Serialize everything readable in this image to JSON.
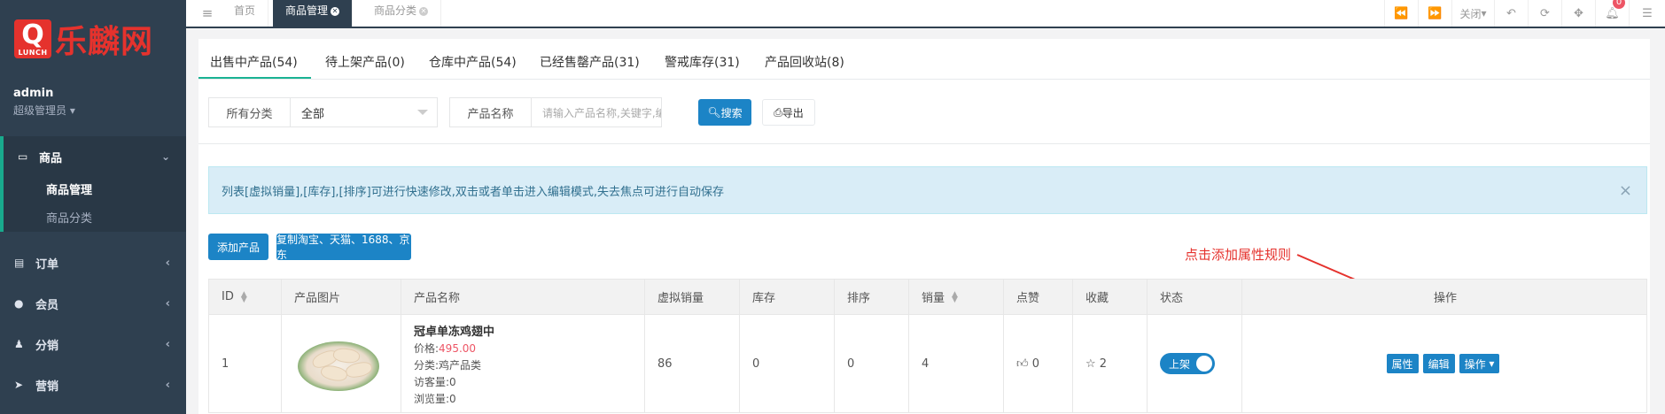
{
  "brand": {
    "logo_mark": "Q",
    "logo_sub": "LUNCH",
    "logo_text": "乐麟网"
  },
  "user": {
    "name": "admin",
    "role": "超级管理员"
  },
  "sidebar": {
    "goods": {
      "label": "商品",
      "items": [
        {
          "label": "商品管理"
        },
        {
          "label": "商品分类"
        }
      ]
    },
    "items": [
      {
        "label": "订单"
      },
      {
        "label": "会员"
      },
      {
        "label": "分销"
      },
      {
        "label": "营销"
      }
    ]
  },
  "page_tabs": [
    {
      "label": "首页"
    },
    {
      "label": "商品管理"
    },
    {
      "label": "商品分类"
    }
  ],
  "toolbar": {
    "close_label": "关闭",
    "notification_count": "0"
  },
  "content_tabs": [
    {
      "label": "出售中产品(54)"
    },
    {
      "label": "待上架产品(0)"
    },
    {
      "label": "仓库中产品(54)"
    },
    {
      "label": "已经售罄产品(31)"
    },
    {
      "label": "警戒库存(31)"
    },
    {
      "label": "产品回收站(8)"
    }
  ],
  "filters": {
    "category_label": "所有分类",
    "category_value": "全部",
    "name_label": "产品名称",
    "name_placeholder": "请输入产品名称,关键字,编号",
    "search_label": "搜索",
    "export_label": "导出"
  },
  "alert": {
    "text": "列表[虚拟销量],[库存],[排序]可进行快速修改,双击或者单击进入编辑模式,失去焦点可进行自动保存"
  },
  "actions": {
    "add_label": "添加产品",
    "copy_label": "复制淘宝、天猫、1688、京东"
  },
  "annotation": "点击添加属性规则",
  "table": {
    "headers": [
      "ID",
      "产品图片",
      "产品名称",
      "虚拟销量",
      "库存",
      "排序",
      "销量",
      "点赞",
      "收藏",
      "状态",
      "操作"
    ],
    "rows": [
      {
        "id": "1",
        "name": "冠卓单冻鸡翅中",
        "price_label": "价格:",
        "price": "495.00",
        "category": "分类:鸡产品类",
        "visitors": "访客量:0",
        "views": "浏览量:0",
        "virtual_sales": "86",
        "stock": "0",
        "sort": "0",
        "sales": "4",
        "likes": "0",
        "favorites": "2",
        "status": "上架",
        "ops": {
          "attr": "属性",
          "edit": "编辑",
          "more": "操作"
        }
      }
    ]
  },
  "colors": {
    "sidebar": "#2f4050",
    "primary": "#1c84c6",
    "accent_tab": "#1ab394",
    "brand_red": "#e5322d"
  }
}
